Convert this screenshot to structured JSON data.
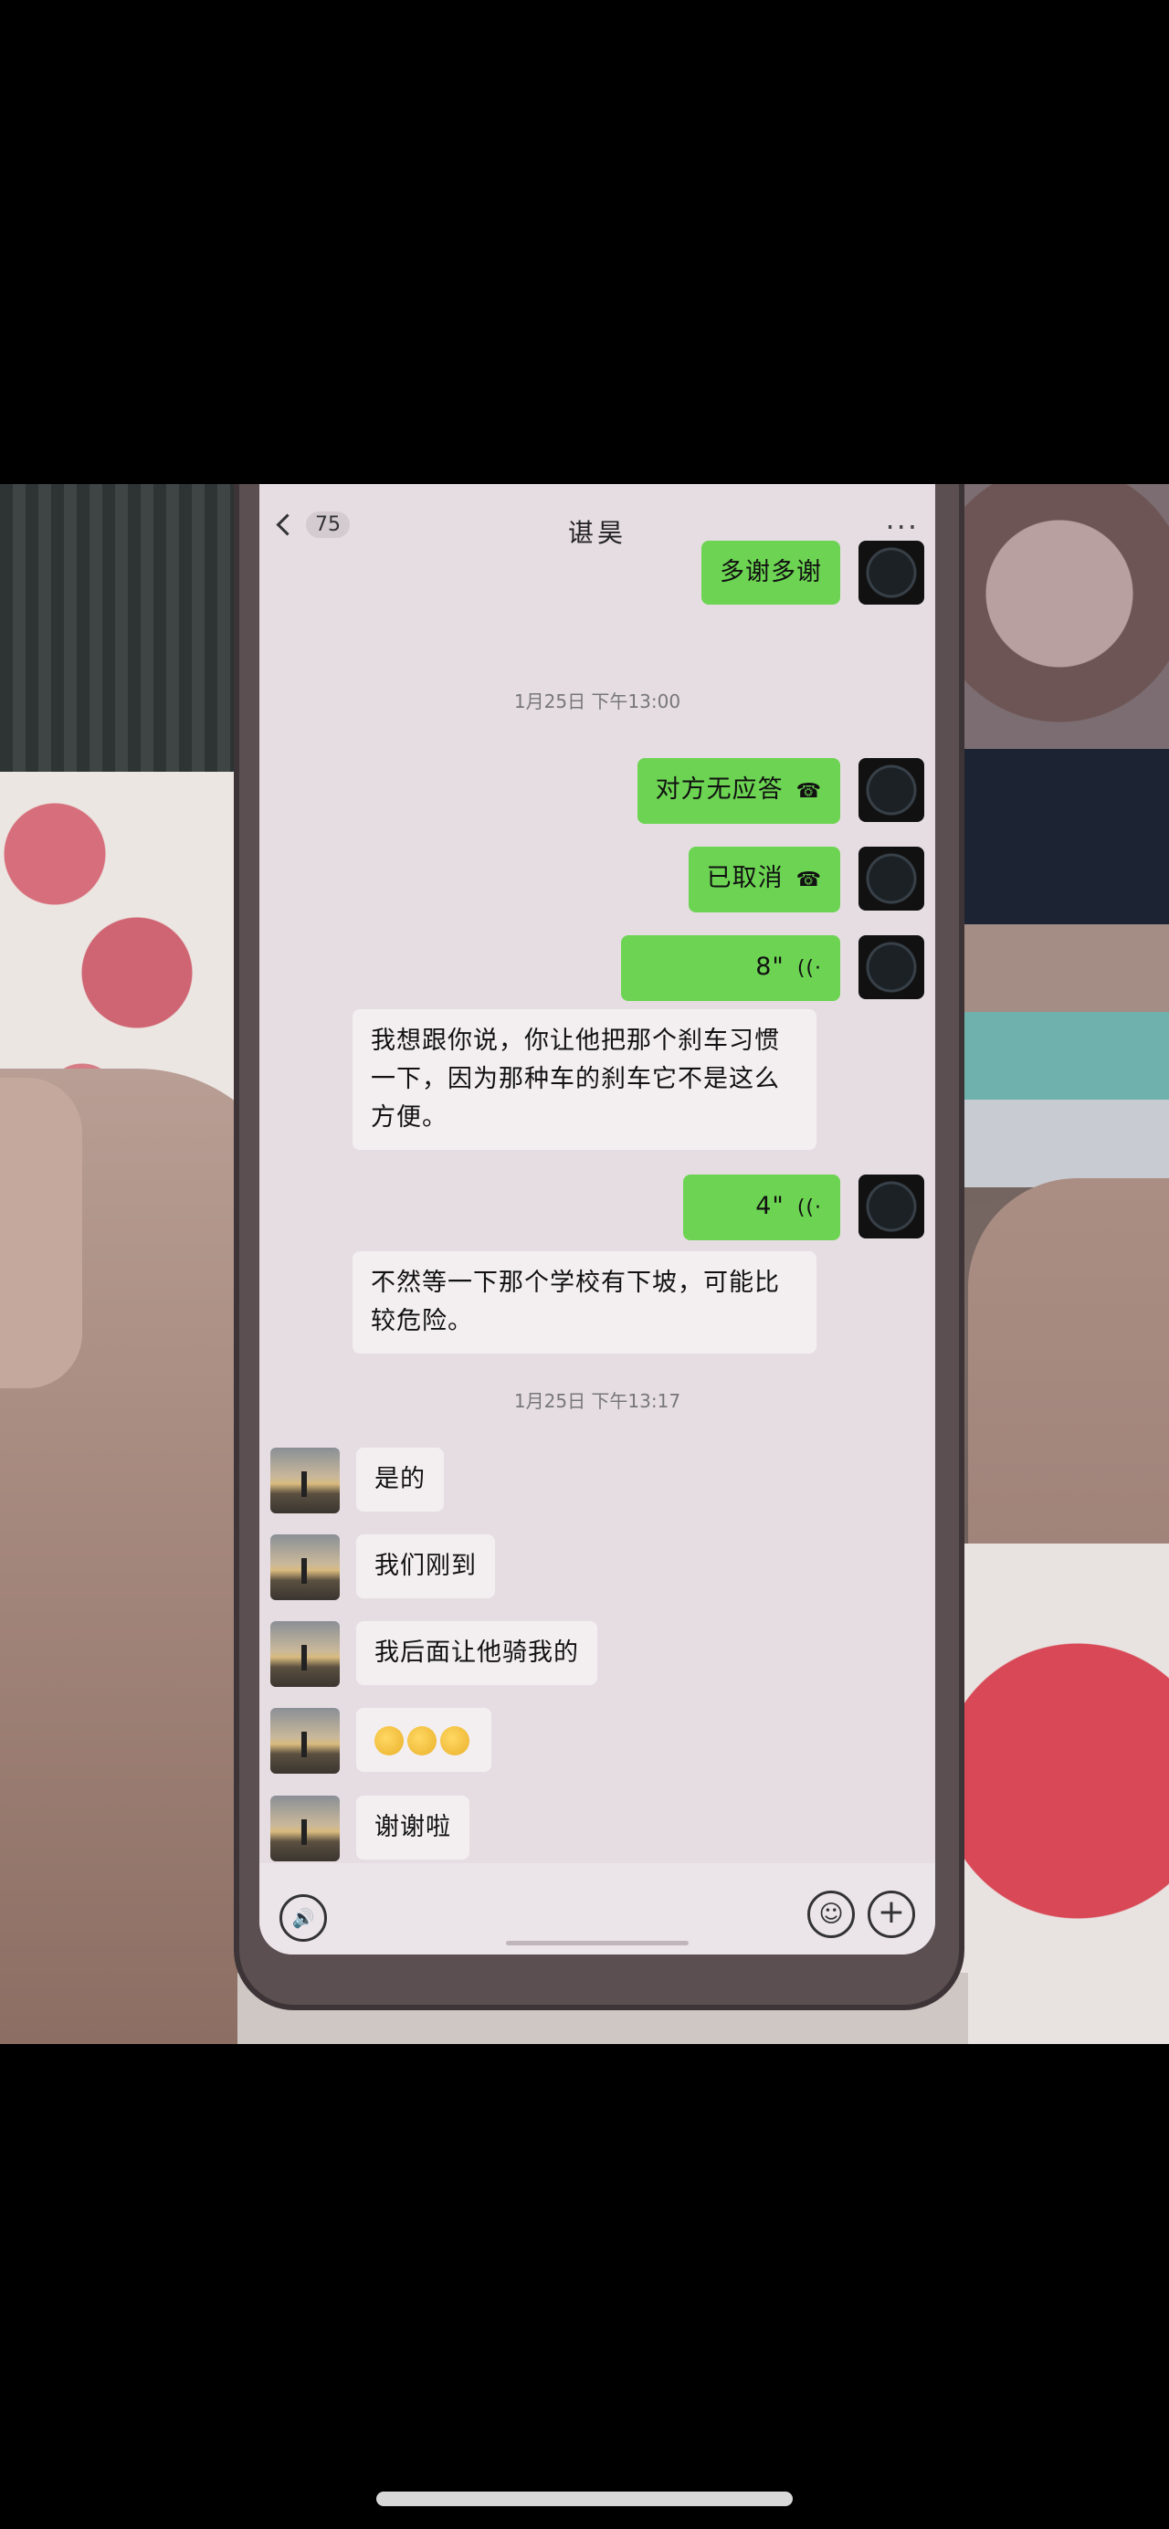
{
  "header": {
    "back_badge": "75",
    "title": "谌昊",
    "more": "···"
  },
  "messages": [
    {
      "side": "out",
      "text": "多谢多谢"
    },
    {
      "type": "timestamp",
      "text": "1月25日 下午13:00"
    },
    {
      "side": "out",
      "text": "对方无应答",
      "icon": "phone-icon"
    },
    {
      "side": "out",
      "text": "已取消",
      "icon": "phone-icon"
    },
    {
      "side": "out",
      "text": "8\"",
      "icon": "voice-wave-icon"
    },
    {
      "side": "in",
      "text": "我想跟你说，你让他把那个刹车习惯一下，因为那种车的刹车它不是这么方便。"
    },
    {
      "side": "out",
      "text": "4\"",
      "icon": "voice-wave-icon"
    },
    {
      "side": "in",
      "text": "不然等一下那个学校有下坡，可能比较危险。"
    },
    {
      "type": "timestamp",
      "text": "1月25日 下午13:17"
    },
    {
      "side": "in",
      "text": "是的"
    },
    {
      "side": "in",
      "text": "我们刚到"
    },
    {
      "side": "in",
      "text": "我后面让他骑我的"
    },
    {
      "side": "in",
      "text": "",
      "emoji_count": 3
    },
    {
      "side": "in",
      "text": "谢谢啦"
    }
  ],
  "colors": {
    "outgoing_bubble": "#6cd452",
    "incoming_bubble": "#f3eff1",
    "screen_bg": "#e6dde2"
  }
}
